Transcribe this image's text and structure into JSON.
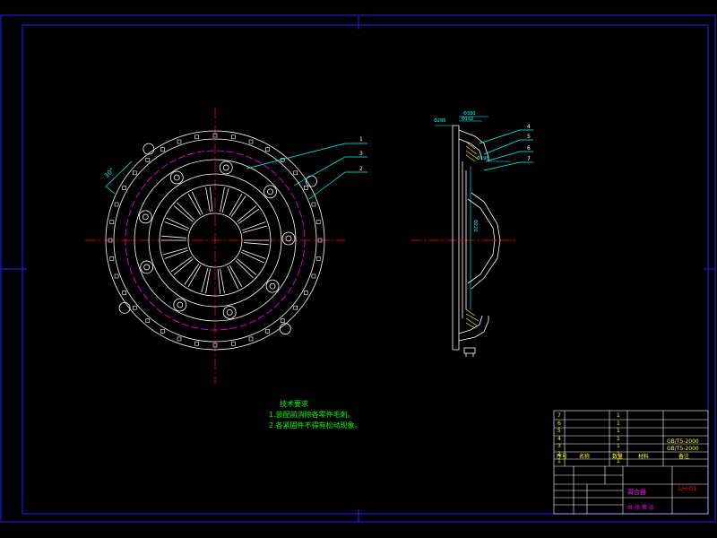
{
  "colors": {
    "frame": "#2020ff",
    "outline": "#ffffff",
    "centerline": "#ff0000",
    "hidden": "#ff00ff",
    "dimension": "#00ffff",
    "leader": "#00ffff",
    "notes": "#00ff00",
    "title_text": "#ffff00",
    "title_magenta": "#ff00ff",
    "title_red": "#ff0000"
  },
  "front_view": {
    "balloons": [
      "1",
      "2",
      "3"
    ],
    "angle_dim": "30°"
  },
  "section_view": {
    "balloons": [
      "4",
      "5",
      "6",
      "7"
    ],
    "dims": [
      "Φ380",
      "Φ286",
      "Φ162",
      "Φ198",
      "Φ220"
    ]
  },
  "tech_notes": {
    "title": "技术要求",
    "items": [
      "1.装配前消除各零件毛刺。",
      "2.各紧固件不得有松动现象。"
    ]
  },
  "parts_list": {
    "rows": [
      {
        "no": "7",
        "name": "",
        "qty": "1",
        "material": ""
      },
      {
        "no": "6",
        "name": "",
        "qty": "1",
        "material": ""
      },
      {
        "no": "5",
        "name": "",
        "qty": "1",
        "material": ""
      },
      {
        "no": "4",
        "name": "",
        "qty": "1",
        "material": ""
      },
      {
        "no": "3",
        "name": "",
        "qty": "1",
        "material": ""
      },
      {
        "no": "2",
        "name": "",
        "qty": "1",
        "material": ""
      },
      {
        "no": "1",
        "name": "",
        "qty": "1",
        "material": ""
      }
    ],
    "header": {
      "no": "序号",
      "name": "名称",
      "qty": "数量",
      "material": "材料",
      "remark": "备注"
    },
    "std_codes": [
      "GB/T5-2000",
      "GB/T5-2000"
    ]
  },
  "title_block": {
    "project": "",
    "drawing_name": "离合器",
    "drawing_no": "LH-01",
    "sheet": "共 张 第 张"
  }
}
